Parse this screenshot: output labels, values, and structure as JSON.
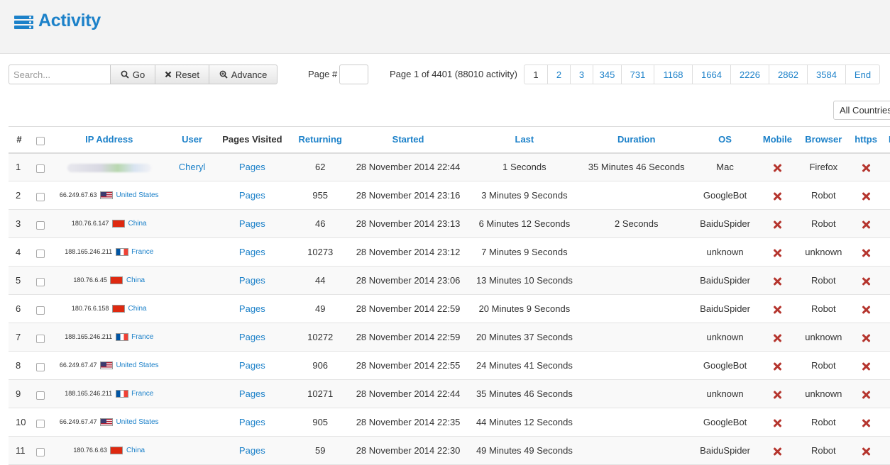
{
  "header": {
    "title": "Activity",
    "icon": "list-icon"
  },
  "search": {
    "placeholder": "Search..."
  },
  "buttons": {
    "go": "Go",
    "reset": "Reset",
    "advance": "Advance"
  },
  "page_jump": {
    "label": "Page #"
  },
  "page_info": "Page 1 of 4401 (88010 activity)",
  "pagination": [
    "1",
    "2",
    "3",
    "345",
    "731",
    "1168",
    "1664",
    "2226",
    "2862",
    "3584",
    "End"
  ],
  "country_filter": {
    "selected": "All Countries"
  },
  "table": {
    "columns": [
      "#",
      "IP Address",
      "User",
      "Pages Visited",
      "Returning",
      "Started",
      "Last",
      "Duration",
      "OS",
      "Mobile",
      "Browser",
      "https",
      "R"
    ],
    "rows": [
      {
        "n": "1",
        "ip": "",
        "flag": "",
        "country": "",
        "user": "Cheryl",
        "pages": "Pages",
        "returning": "62",
        "started": "28 November 2014 22:44",
        "last": "1 Seconds",
        "duration": "35 Minutes 46 Seconds",
        "os": "Mac",
        "browser": "Firefox"
      },
      {
        "n": "2",
        "ip": "66.249.67.63",
        "flag": "us",
        "country": "United States",
        "user": "",
        "pages": "Pages",
        "returning": "955",
        "started": "28 November 2014 23:16",
        "last": "3 Minutes 9 Seconds",
        "duration": "",
        "os": "GoogleBot",
        "browser": "Robot"
      },
      {
        "n": "3",
        "ip": "180.76.6.147",
        "flag": "cn",
        "country": "China",
        "user": "",
        "pages": "Pages",
        "returning": "46",
        "started": "28 November 2014 23:13",
        "last": "6 Minutes 12 Seconds",
        "duration": "2 Seconds",
        "os": "BaiduSpider",
        "browser": "Robot"
      },
      {
        "n": "4",
        "ip": "188.165.246.211",
        "flag": "fr",
        "country": "France",
        "user": "",
        "pages": "Pages",
        "returning": "10273",
        "started": "28 November 2014 23:12",
        "last": "7 Minutes 9 Seconds",
        "duration": "",
        "os": "unknown",
        "browser": "unknown"
      },
      {
        "n": "5",
        "ip": "180.76.6.45",
        "flag": "cn",
        "country": "China",
        "user": "",
        "pages": "Pages",
        "returning": "44",
        "started": "28 November 2014 23:06",
        "last": "13 Minutes 10 Seconds",
        "duration": "",
        "os": "BaiduSpider",
        "browser": "Robot"
      },
      {
        "n": "6",
        "ip": "180.76.6.158",
        "flag": "cn",
        "country": "China",
        "user": "",
        "pages": "Pages",
        "returning": "49",
        "started": "28 November 2014 22:59",
        "last": "20 Minutes 9 Seconds",
        "duration": "",
        "os": "BaiduSpider",
        "browser": "Robot"
      },
      {
        "n": "7",
        "ip": "188.165.246.211",
        "flag": "fr",
        "country": "France",
        "user": "",
        "pages": "Pages",
        "returning": "10272",
        "started": "28 November 2014 22:59",
        "last": "20 Minutes 37 Seconds",
        "duration": "",
        "os": "unknown",
        "browser": "unknown"
      },
      {
        "n": "8",
        "ip": "66.249.67.47",
        "flag": "us",
        "country": "United States",
        "user": "",
        "pages": "Pages",
        "returning": "906",
        "started": "28 November 2014 22:55",
        "last": "24 Minutes 41 Seconds",
        "duration": "",
        "os": "GoogleBot",
        "browser": "Robot"
      },
      {
        "n": "9",
        "ip": "188.165.246.211",
        "flag": "fr",
        "country": "France",
        "user": "",
        "pages": "Pages",
        "returning": "10271",
        "started": "28 November 2014 22:44",
        "last": "35 Minutes 46 Seconds",
        "duration": "",
        "os": "unknown",
        "browser": "unknown"
      },
      {
        "n": "10",
        "ip": "66.249.67.47",
        "flag": "us",
        "country": "United States",
        "user": "",
        "pages": "Pages",
        "returning": "905",
        "started": "28 November 2014 22:35",
        "last": "44 Minutes 12 Seconds",
        "duration": "",
        "os": "GoogleBot",
        "browser": "Robot"
      },
      {
        "n": "11",
        "ip": "180.76.6.63",
        "flag": "cn",
        "country": "China",
        "user": "",
        "pages": "Pages",
        "returning": "59",
        "started": "28 November 2014 22:30",
        "last": "49 Minutes 49 Seconds",
        "duration": "",
        "os": "BaiduSpider",
        "browser": "Robot"
      }
    ]
  },
  "colors": {
    "accent": "#1c81c9",
    "status_no": "#b5352e"
  }
}
